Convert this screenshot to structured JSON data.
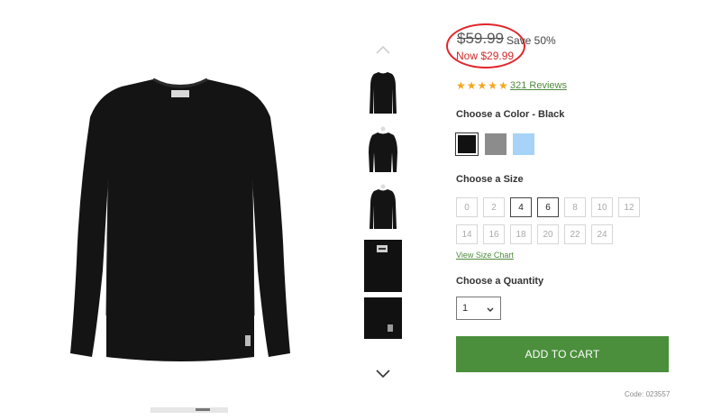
{
  "price": {
    "old": "$59.99",
    "save": "Save 50%",
    "now": "Now $29.99"
  },
  "rating": {
    "stars": "★★★★★",
    "reviews": "321 Reviews"
  },
  "color": {
    "label": "Choose a Color - Black",
    "options": [
      {
        "name": "Black",
        "hex": "#111111",
        "selected": true
      },
      {
        "name": "Grey",
        "hex": "#8c8c8c",
        "selected": false
      },
      {
        "name": "Light Blue",
        "hex": "#a6d3f7",
        "selected": false
      }
    ]
  },
  "size": {
    "label": "Choose a Size",
    "options": [
      "0",
      "2",
      "4",
      "6",
      "8",
      "10",
      "12",
      "14",
      "16",
      "18",
      "20",
      "22",
      "24"
    ],
    "available": [
      "4",
      "6"
    ],
    "chart_link": "View Size Chart"
  },
  "quantity": {
    "label": "Choose a Quantity",
    "value": "1"
  },
  "cart": {
    "button": "ADD TO CART"
  },
  "product_code": "Code: 023557",
  "icons": {
    "up": "chevron-up-icon",
    "down": "chevron-down-icon"
  }
}
